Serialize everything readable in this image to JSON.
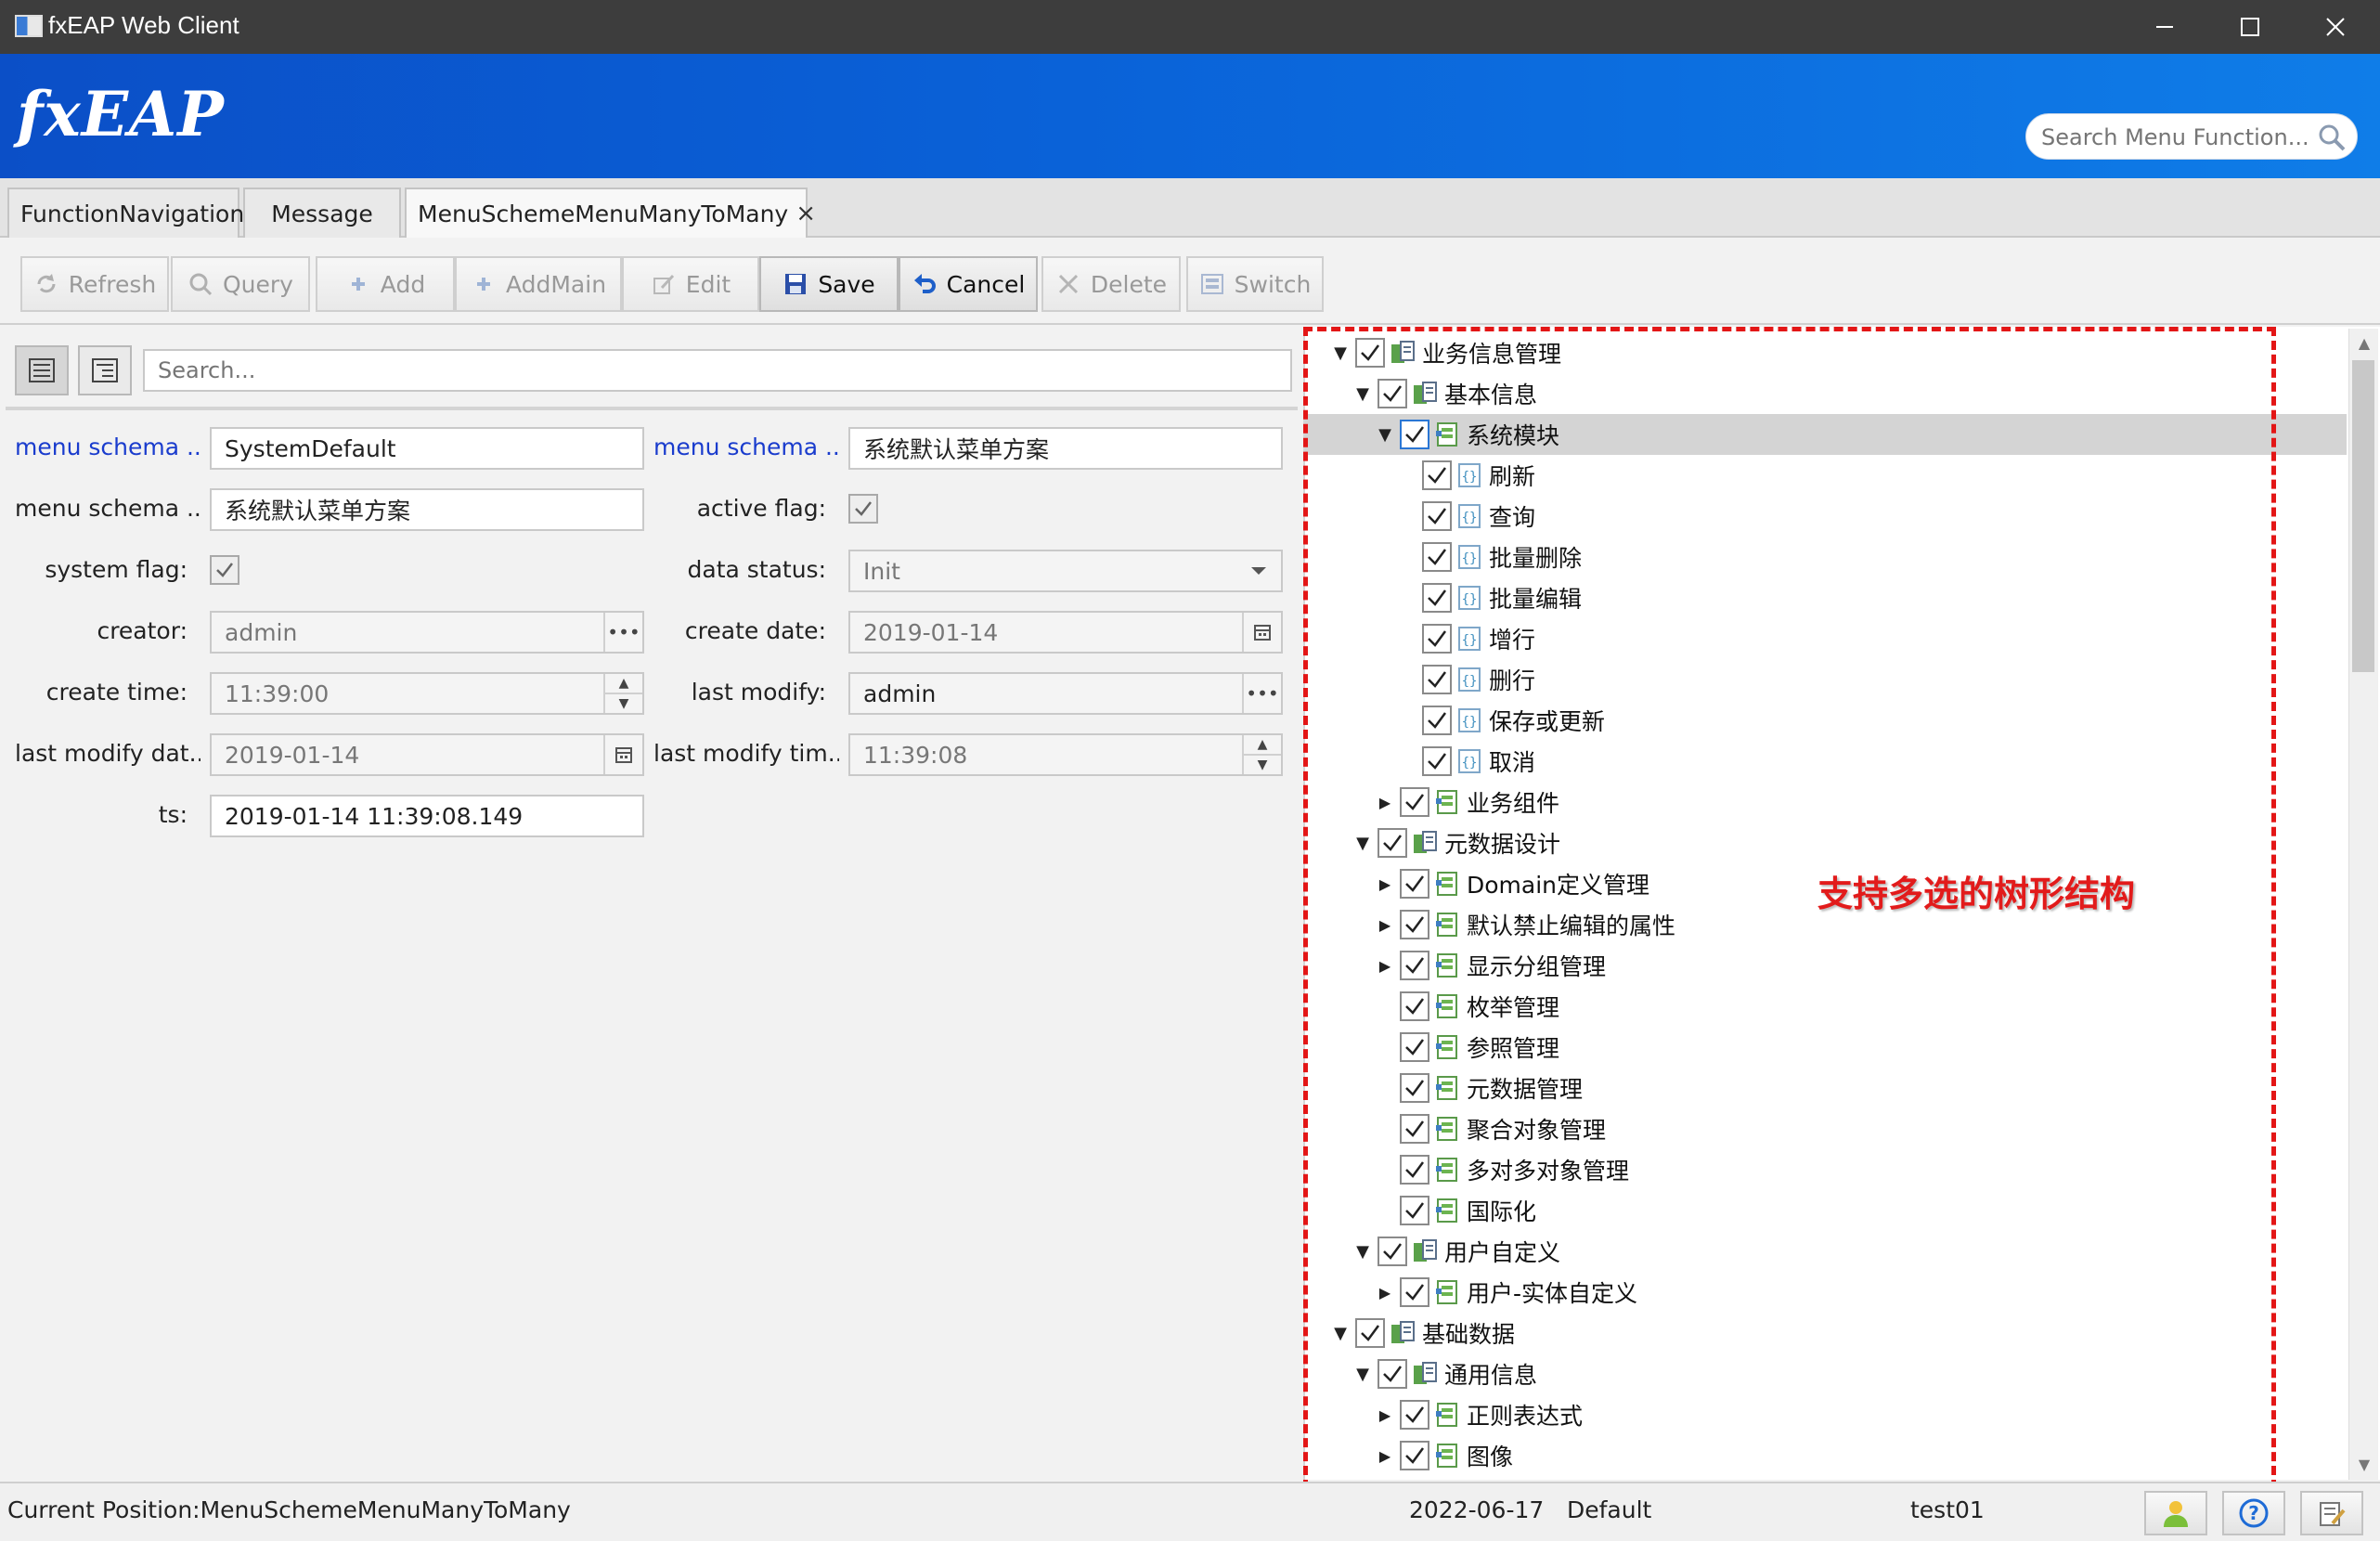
{
  "window": {
    "title": "fxEAP Web Client",
    "minimize_icon": "minimize-icon",
    "maximize_icon": "maximize-icon",
    "close_icon": "close-icon"
  },
  "banner": {
    "logo": "fxEAP",
    "search_placeholder": "Search Menu Function...",
    "search_icon": "magnifier-icon",
    "gradient_colors": [
      "#0b4fc7",
      "#0f7de8"
    ]
  },
  "tabs": [
    {
      "label": "FunctionNavigation",
      "active": false
    },
    {
      "label": "Message",
      "active": false
    },
    {
      "label": "MenuSchemeMenuManyToMany",
      "active": true,
      "closable": true,
      "close_label": "×"
    }
  ],
  "toolbar": {
    "refresh": "Refresh",
    "query": "Query",
    "add": "Add",
    "addmain": "AddMain",
    "edit": "Edit",
    "save": "Save",
    "cancel": "Cancel",
    "delete": "Delete",
    "switch": "Switch"
  },
  "form": {
    "search_placeholder": "Search...",
    "fields": {
      "menu_schema_code_label": "menu schema ...",
      "menu_schema_code_value": "SystemDefault",
      "menu_schema_name_label": "menu schema ...",
      "menu_schema_name_value": "系统默认菜单方案",
      "menu_schema_desc_label": "menu schema ...",
      "menu_schema_desc_value": "系统默认菜单方案",
      "active_flag_label": "active flag:",
      "active_flag_checked": true,
      "system_flag_label": "system flag:",
      "system_flag_checked": true,
      "data_status_label": "data status:",
      "data_status_value": "Init",
      "creator_label": "creator:",
      "creator_value": "admin",
      "create_date_label": "create date:",
      "create_date_value": "2019-01-14",
      "create_time_label": "create time:",
      "create_time_value": "11:39:00",
      "last_modify_label": "last modify:",
      "last_modify_value": "admin",
      "last_modify_date_label": "last modify dat...",
      "last_modify_date_value": "2019-01-14",
      "last_modify_time_label": "last modify tim...",
      "last_modify_time_value": "11:39:08",
      "ts_label": "ts:",
      "ts_value": "2019-01-14 11:39:08.149"
    }
  },
  "tree": {
    "annotation": "支持多选的树形结构",
    "frame_color": "#e31616",
    "nodes": [
      {
        "label": "业务信息管理",
        "depth": 0,
        "expanded": true,
        "type": "group"
      },
      {
        "label": "基本信息",
        "depth": 1,
        "expanded": true,
        "type": "group"
      },
      {
        "label": "系统模块",
        "depth": 2,
        "expanded": true,
        "type": "module",
        "selected": true
      },
      {
        "label": "刷新",
        "depth": 3,
        "leaf": true,
        "type": "function"
      },
      {
        "label": "查询",
        "depth": 3,
        "leaf": true,
        "type": "function"
      },
      {
        "label": "批量删除",
        "depth": 3,
        "leaf": true,
        "type": "function"
      },
      {
        "label": "批量编辑",
        "depth": 3,
        "leaf": true,
        "type": "function"
      },
      {
        "label": "增行",
        "depth": 3,
        "leaf": true,
        "type": "function"
      },
      {
        "label": "删行",
        "depth": 3,
        "leaf": true,
        "type": "function"
      },
      {
        "label": "保存或更新",
        "depth": 3,
        "leaf": true,
        "type": "function"
      },
      {
        "label": "取消",
        "depth": 3,
        "leaf": true,
        "type": "function"
      },
      {
        "label": "业务组件",
        "depth": 2,
        "expanded": false,
        "type": "module"
      },
      {
        "label": "元数据设计",
        "depth": 1,
        "expanded": true,
        "type": "group"
      },
      {
        "label": "Domain定义管理",
        "depth": 2,
        "expanded": false,
        "type": "module"
      },
      {
        "label": "默认禁止编辑的属性",
        "depth": 2,
        "expanded": false,
        "type": "module"
      },
      {
        "label": "显示分组管理",
        "depth": 2,
        "expanded": false,
        "type": "module"
      },
      {
        "label": "枚举管理",
        "depth": 2,
        "leaf": true,
        "type": "module"
      },
      {
        "label": "参照管理",
        "depth": 2,
        "leaf": true,
        "type": "module"
      },
      {
        "label": "元数据管理",
        "depth": 2,
        "leaf": true,
        "type": "module"
      },
      {
        "label": "聚合对象管理",
        "depth": 2,
        "leaf": true,
        "type": "module"
      },
      {
        "label": "多对多对象管理",
        "depth": 2,
        "leaf": true,
        "type": "module"
      },
      {
        "label": "国际化",
        "depth": 2,
        "leaf": true,
        "type": "module"
      },
      {
        "label": "用户自定义",
        "depth": 1,
        "expanded": true,
        "type": "group"
      },
      {
        "label": "用户-实体自定义",
        "depth": 2,
        "expanded": false,
        "type": "module"
      },
      {
        "label": "基础数据",
        "depth": 0,
        "expanded": true,
        "type": "group"
      },
      {
        "label": "通用信息",
        "depth": 1,
        "expanded": true,
        "type": "group"
      },
      {
        "label": "正则表达式",
        "depth": 2,
        "expanded": false,
        "type": "module"
      },
      {
        "label": "图像",
        "depth": 2,
        "expanded": false,
        "type": "module"
      }
    ]
  },
  "statusbar": {
    "position": "Current Position:MenuSchemeMenuManyToMany",
    "date": "2022-06-17",
    "scheme": "Default",
    "user": "test01",
    "user_icon": "user-icon",
    "help_icon": "help-icon",
    "notes_icon": "notes-icon"
  }
}
